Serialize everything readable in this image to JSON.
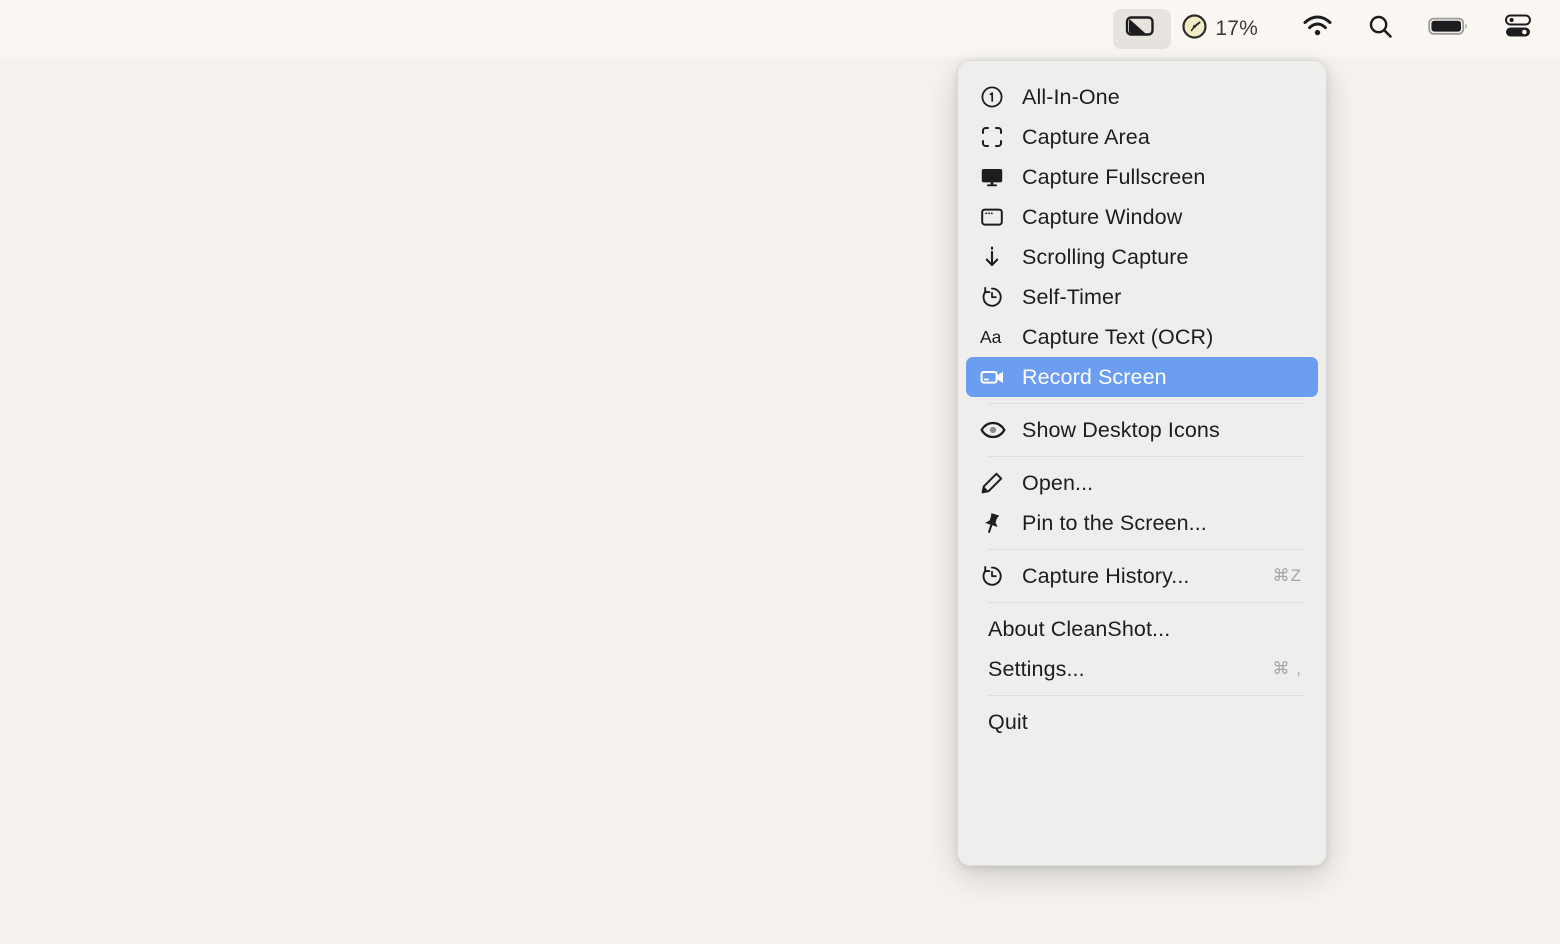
{
  "menubar": {
    "app_icon": "cleanshot-icon",
    "app_icon_active": true,
    "timer_icon": "stopwatch-icon",
    "battery_percent": "17%",
    "wifi_icon": "wifi-icon",
    "search_icon": "search-icon",
    "battery_icon": "battery-icon",
    "control_center_icon": "control-center-icon"
  },
  "menu": {
    "sections": [
      {
        "items": [
          {
            "label": "All-In-One",
            "icon": "number-one-circle-icon",
            "shortcut": "",
            "selected": false
          },
          {
            "label": "Capture Area",
            "icon": "crop-area-icon",
            "shortcut": "",
            "selected": false
          },
          {
            "label": "Capture Fullscreen",
            "icon": "monitor-icon",
            "shortcut": "",
            "selected": false
          },
          {
            "label": "Capture Window",
            "icon": "window-icon",
            "shortcut": "",
            "selected": false
          },
          {
            "label": "Scrolling Capture",
            "icon": "arrow-down-icon",
            "shortcut": "",
            "selected": false
          },
          {
            "label": "Self-Timer",
            "icon": "timer-icon",
            "shortcut": "",
            "selected": false
          },
          {
            "label": "Capture Text (OCR)",
            "icon": "text-aa-icon",
            "shortcut": "",
            "selected": false
          },
          {
            "label": "Record Screen",
            "icon": "video-camera-icon",
            "shortcut": "",
            "selected": true
          }
        ]
      },
      {
        "items": [
          {
            "label": "Show Desktop Icons",
            "icon": "eye-icon",
            "shortcut": "",
            "selected": false
          }
        ]
      },
      {
        "items": [
          {
            "label": "Open...",
            "icon": "pencil-icon",
            "shortcut": "",
            "selected": false
          },
          {
            "label": "Pin to the Screen...",
            "icon": "pin-icon",
            "shortcut": "",
            "selected": false
          }
        ]
      },
      {
        "items": [
          {
            "label": "Capture History...",
            "icon": "history-clock-icon",
            "shortcut": "⌘Z",
            "selected": false
          }
        ]
      },
      {
        "items": [
          {
            "label": "About CleanShot...",
            "icon": "",
            "shortcut": "",
            "selected": false
          },
          {
            "label": "Settings...",
            "icon": "",
            "shortcut": "⌘ ,",
            "selected": false
          }
        ]
      },
      {
        "items": [
          {
            "label": "Quit",
            "icon": "",
            "shortcut": "",
            "selected": false
          }
        ]
      }
    ]
  },
  "colors": {
    "desktop_background": "#f5f2ef",
    "menubar_background": "#fbf8f4",
    "panel_background": "#eeeeed",
    "selection_blue": "#6b9ef0",
    "label_text": "#1d1d1f",
    "shortcut_text": "#a6a6a6"
  }
}
